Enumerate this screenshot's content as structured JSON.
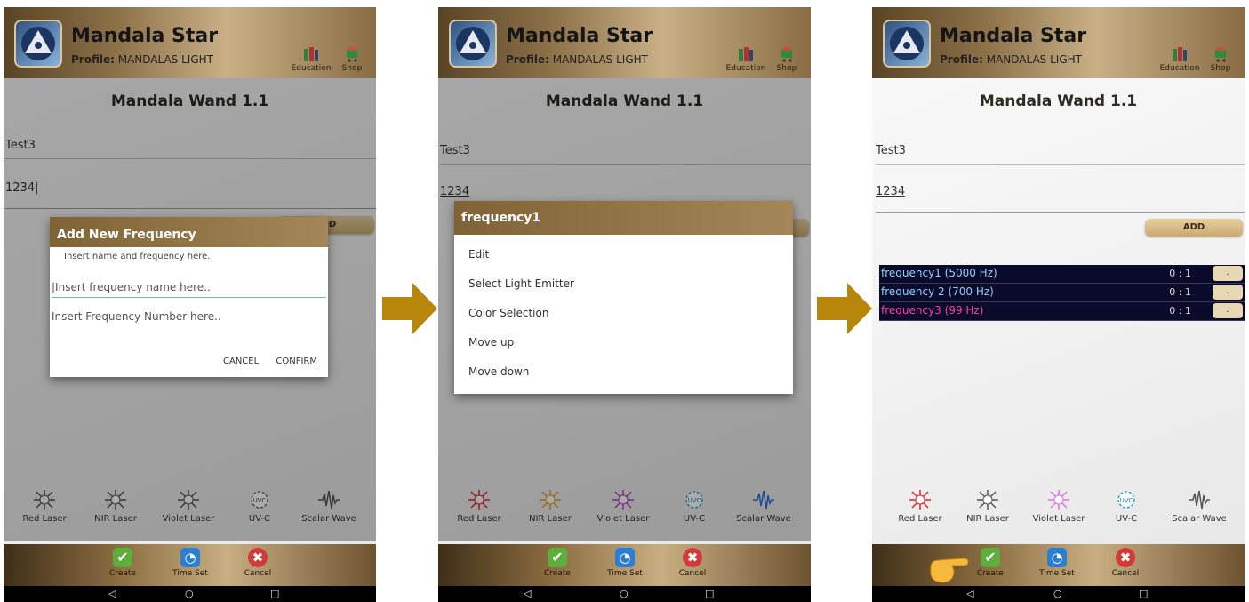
{
  "app": {
    "title": "Mandala Star",
    "profile_label": "Profile:",
    "profile_name": "MANDALAS LIGHT",
    "education": "Education",
    "shop": "Shop",
    "page_title": "Mandala Wand 1.1"
  },
  "fields": {
    "name_value": "Test3",
    "number_value": "1234"
  },
  "add_button": "ADD",
  "add_dialog": {
    "title": "Add New Frequency",
    "hint": "Insert name and frequency here.",
    "name_placeholder": "Insert frequency name here..",
    "number_placeholder": "Insert Frequency Number here..",
    "cancel": "CANCEL",
    "confirm": "CONFIRM"
  },
  "context_menu": {
    "title": "frequency1",
    "items": [
      "Edit",
      "Select Light Emitter",
      "Color Selection",
      "Move up",
      "Move down"
    ]
  },
  "frequencies": [
    {
      "name": "frequency1 (5000 Hz)",
      "ratio": "0 : 1",
      "color": "#8fd0ff"
    },
    {
      "name": "frequency 2 (700 Hz)",
      "ratio": "0 : 1",
      "color": "#8fd0ff"
    },
    {
      "name": "frequency3 (99 Hz)",
      "ratio": "0 : 1",
      "color": "#ff3fa4"
    }
  ],
  "emitters": {
    "red": "Red Laser",
    "nir": "NIR Laser",
    "violet": "Violet Laser",
    "uvc": "UV-C",
    "scalar": "Scalar Wave"
  },
  "footer": {
    "create": "Create",
    "timeset": "Time Set",
    "cancel": "Cancel"
  },
  "nav": {
    "back": "◁",
    "home": "○",
    "recent": "□"
  },
  "colors": {
    "accent": "#a88a55",
    "arrow": "#b8860b",
    "list_bg": "#0a0a2a"
  }
}
